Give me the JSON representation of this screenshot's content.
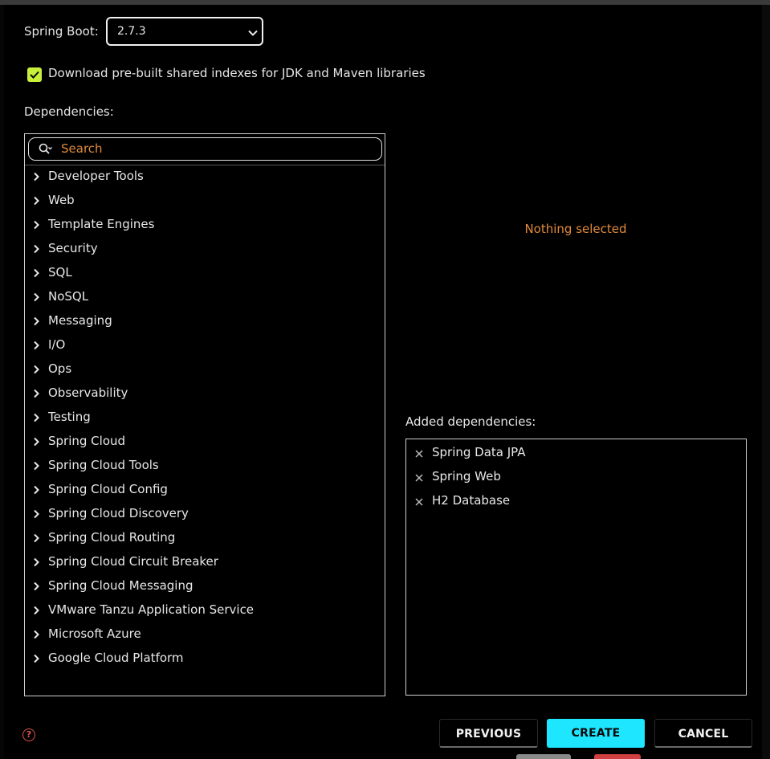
{
  "spring_boot": {
    "label": "Spring Boot:",
    "selected": "2.7.3"
  },
  "shared_indexes": {
    "checked": true,
    "label": "Download pre-built shared indexes for JDK and Maven libraries"
  },
  "dependencies": {
    "label": "Dependencies:",
    "search_placeholder": "Search",
    "categories": [
      "Developer Tools",
      "Web",
      "Template Engines",
      "Security",
      "SQL",
      "NoSQL",
      "Messaging",
      "I/O",
      "Ops",
      "Observability",
      "Testing",
      "Spring Cloud",
      "Spring Cloud Tools",
      "Spring Cloud Config",
      "Spring Cloud Discovery",
      "Spring Cloud Routing",
      "Spring Cloud Circuit Breaker",
      "Spring Cloud Messaging",
      "VMware Tanzu Application Service",
      "Microsoft Azure",
      "Google Cloud Platform"
    ]
  },
  "details": {
    "empty_text": "Nothing selected"
  },
  "added": {
    "label": "Added dependencies:",
    "items": [
      "Spring Data JPA",
      "Spring Web",
      "H2 Database"
    ]
  },
  "help": {
    "glyph": "?"
  },
  "buttons": {
    "previous": "PREVIOUS",
    "create": "CREATE",
    "cancel": "CANCEL"
  },
  "colors": {
    "accent": "#1ee6ff",
    "checkbox": "#c8f03a",
    "hint": "#e08a3c",
    "help": "#e0524c"
  },
  "icons": {
    "category_expand": "chevron-right-icon",
    "remove": "close-icon",
    "search": "search-icon",
    "select": "chevron-down-icon"
  }
}
